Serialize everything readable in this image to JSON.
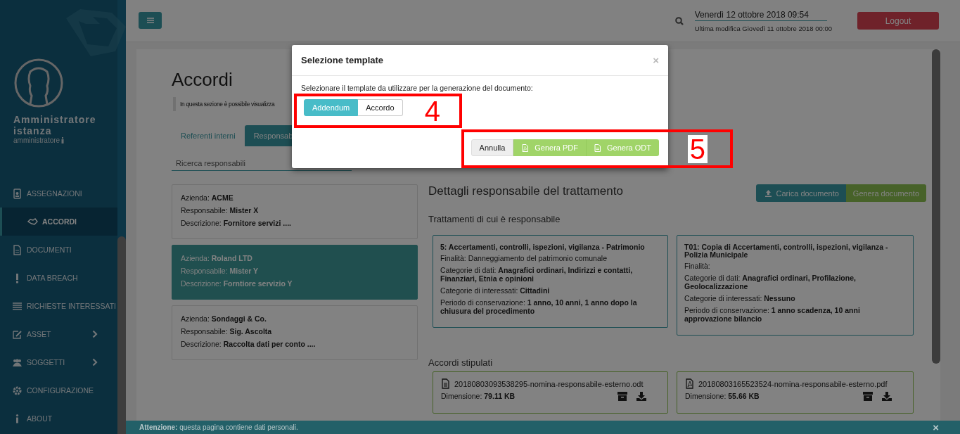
{
  "sidebar": {
    "user": {
      "name": "Amministratore istanza",
      "role": "amministratore"
    },
    "items": [
      {
        "label": "ASSEGNAZIONI",
        "expandable": false,
        "selected": false
      },
      {
        "label": "ACCORDI",
        "expandable": false,
        "selected": true
      },
      {
        "label": "DOCUMENTI",
        "expandable": false,
        "selected": false
      },
      {
        "label": "DATA BREACH",
        "expandable": false,
        "selected": false
      },
      {
        "label": "RICHIESTE INTERESSATI",
        "expandable": false,
        "selected": false
      },
      {
        "label": "ASSET",
        "expandable": true,
        "selected": false
      },
      {
        "label": "SOGGETTI",
        "expandable": true,
        "selected": false
      },
      {
        "label": "CONFIGURAZIONE",
        "expandable": false,
        "selected": false
      },
      {
        "label": "ABOUT",
        "expandable": false,
        "selected": false
      }
    ]
  },
  "header": {
    "datetime": "Venerdì 12 ottobre 2018 09:54",
    "last_modified": "Ultima modifica Giovedì 11 ottobre 2018 00:00",
    "logout": "Logout"
  },
  "page": {
    "title": "Accordi",
    "intro": "In questa sezione è possibile visualizza",
    "tabs": [
      {
        "label": "Referenti interni",
        "selected": false
      },
      {
        "label": "Responsab",
        "selected": true
      }
    ],
    "search": {
      "placeholder": "Ricerca responsabili"
    },
    "responsabili": [
      {
        "lines": [
          "Azienda: **ACME**",
          "Responsabile: **Mister X**",
          "Descrizione: **Fornitore servizi ....**"
        ],
        "selected": false
      },
      {
        "lines": [
          "Azienda: **Roland LTD**",
          "Responsabile: **Mister Y**",
          "Descrizione: **Forntiore servizio Y**"
        ],
        "selected": true
      },
      {
        "lines": [
          "Azienda: **Sondaggi & Co.**",
          "Responsabile: **Sig. Ascolta**",
          "Descrizione: **Raccolta dati per conto ....**"
        ],
        "selected": false
      }
    ],
    "details": {
      "title": "Dettagli responsabile del trattamento",
      "buttons": [
        {
          "label": "Carica documento",
          "kind": "upload"
        },
        {
          "label": "Genera documento",
          "kind": "generate"
        }
      ],
      "treatments_title": "Trattamenti di cui è responsabile",
      "treatments": [
        {
          "title": "5: Accertamenti, controlli, ispezioni, vigilanza - Patrimonio",
          "lines": [
            "Finalità: Danneggiamento del patrimonio comunale",
            "Categorie di dati: **Anagrafici ordinari, Indirizzi e contatti, Finanziari, Etnia e opinioni**",
            "Categorie di interessati: **Cittadini**",
            "Periodo di conservazione: **1 anno, 10 anni, 1 anno dopo la chiusura del procedimento**"
          ]
        },
        {
          "title": "T01: Copia di Accertamenti, controlli, ispezioni, vigilanza - Polizia Municipale",
          "lines": [
            "Finalità:",
            "Categorie di dati: **Anagrafici ordinari, Profilazione, Geolocalizzazione**",
            "Categorie di interessati: **Nessuno**",
            "Periodo di conservazione: **1 anno scadenza, 10 anni approvazione bilancio**"
          ]
        }
      ],
      "agreements_title": "Accordi stipulati",
      "agreements": [
        {
          "filename": "20180803093538295-nomina-responsabile-esterno.odt",
          "kind": "odt",
          "size": "Dimensione: **79.11 KB**"
        },
        {
          "filename": "20180803165523524-nomina-responsabile-esterno.pdf",
          "kind": "pdf",
          "size": "Dimensione: **55.66 KB**"
        }
      ]
    }
  },
  "modal": {
    "title": "Selezione template",
    "close": "×",
    "text": "Selezionare il template da utilizzare per la generazione del documento:",
    "options": [
      {
        "label": "Addendum",
        "selected": true
      },
      {
        "label": "Accordo",
        "selected": false
      }
    ],
    "buttons": [
      {
        "label": "Annulla",
        "kind": "cancel"
      },
      {
        "label": "Genera PDF",
        "kind": "pdf"
      },
      {
        "label": "Genera ODT",
        "kind": "odt"
      }
    ]
  },
  "footer": {
    "text": "**Attenzione:** questa pagina contiene dati personali.",
    "close": "×"
  },
  "annotations": [
    {
      "label": "4"
    },
    {
      "label": "5"
    }
  ]
}
